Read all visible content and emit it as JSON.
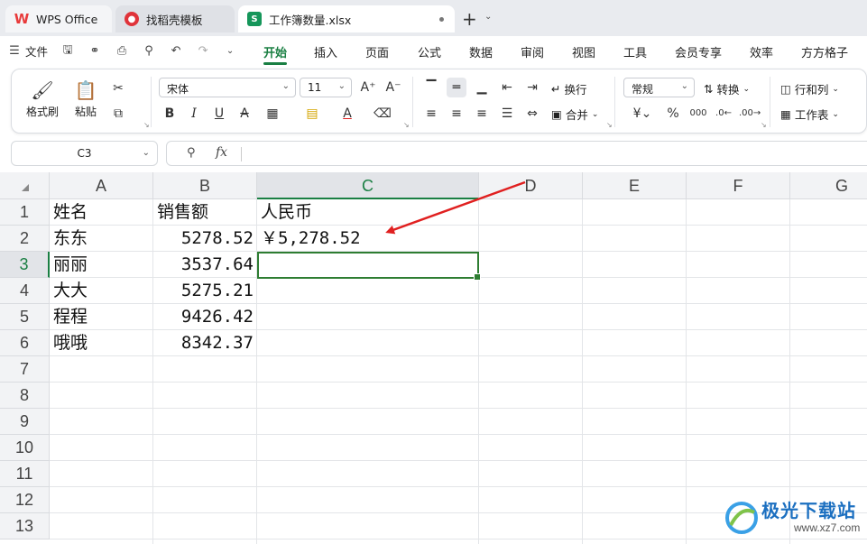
{
  "tabs": [
    {
      "label": "WPS Office",
      "icon": "wps-logo-icon"
    },
    {
      "label": "找稻壳模板",
      "icon": "docer-icon"
    },
    {
      "label": "工作簿数量.xlsx",
      "icon": "spreadsheet-icon",
      "icon_letter": "S"
    }
  ],
  "menu": {
    "file": "文件",
    "items": [
      "开始",
      "插入",
      "页面",
      "公式",
      "数据",
      "审阅",
      "视图",
      "工具",
      "会员专享",
      "效率",
      "方方格子"
    ],
    "active": "开始"
  },
  "ribbon": {
    "format_painter": "格式刷",
    "paste": "粘贴",
    "font_name": "宋体",
    "font_size": "11",
    "wrap": "换行",
    "merge": "合并",
    "number_format": "常规",
    "convert": "转换",
    "rows_cols": "行和列",
    "worksheet": "工作表",
    "currency_symbol": "¥",
    "percent_symbol": "%"
  },
  "formula_bar": {
    "cell_ref": "C3",
    "fx": "fx",
    "content": ""
  },
  "sheet": {
    "columns": [
      "A",
      "B",
      "C",
      "D",
      "E",
      "F",
      "G"
    ],
    "selected_column": "C",
    "rows": [
      "1",
      "2",
      "3",
      "4",
      "5",
      "6",
      "7",
      "8",
      "9",
      "10",
      "11",
      "12",
      "13"
    ],
    "selected_row": "3",
    "cells": {
      "A1": "姓名",
      "B1": "销售额",
      "C1": "人民币",
      "A2": "东东",
      "B2": "5278.52",
      "C2": "￥5,278.52",
      "A3": "丽丽",
      "B3": "3537.64",
      "A4": "大大",
      "B4": "5275.21",
      "A5": "程程",
      "B5": "9426.42",
      "A6": "哦哦",
      "B6": "8342.37"
    },
    "annotation_color": "#e02020",
    "selection_color": "#2e7d32"
  },
  "watermark": {
    "name": "极光下载站",
    "url": "www.xz7.com"
  }
}
